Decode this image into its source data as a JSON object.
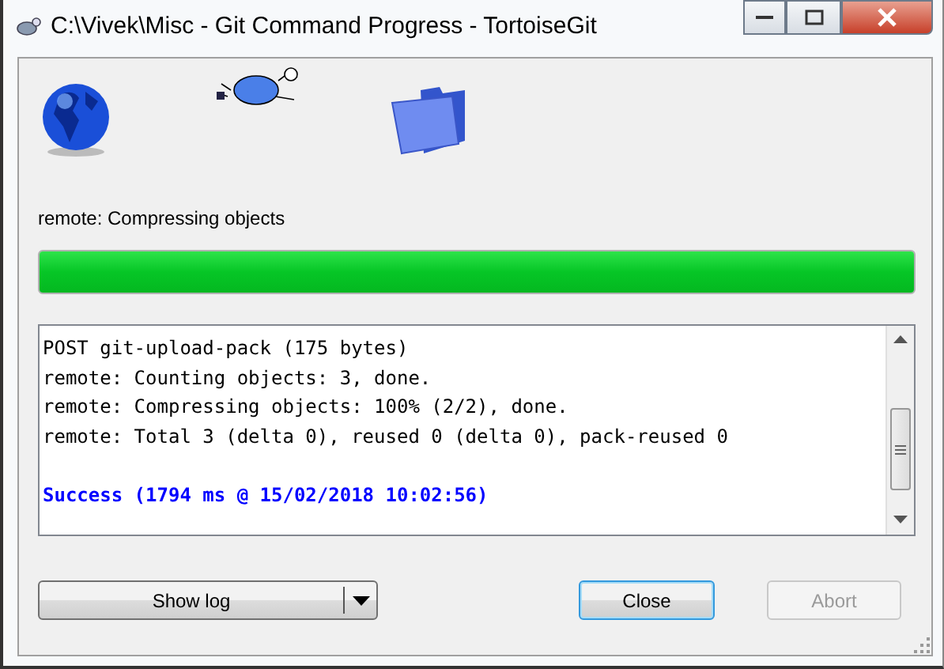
{
  "window": {
    "title": "C:\\Vivek\\Misc - Git Command Progress - TortoiseGit"
  },
  "status": {
    "text": "remote: Compressing objects"
  },
  "progress": {
    "level": 1
  },
  "log": {
    "lines": [
      {
        "kind": "plain",
        "text": "POST git-upload-pack (175 bytes)"
      },
      {
        "kind": "plain",
        "text": "remote: Counting objects: 3, done."
      },
      {
        "kind": "plain",
        "text": "remote: Compressing objects: 100% (2/2), done."
      },
      {
        "kind": "plain",
        "text": "remote: Total 3 (delta 0), reused 0 (delta 0), pack-reused 0"
      },
      {
        "kind": "blank"
      },
      {
        "kind": "success",
        "text": "Success (1794 ms @ 15/02/2018 10:02:56)"
      }
    ]
  },
  "buttons": [
    {
      "kind": "split",
      "label": "Show log",
      "disabled": false,
      "default": false
    },
    {
      "kind": "plain",
      "label": "Close",
      "disabled": false,
      "default": true
    },
    {
      "kind": "plain",
      "label": "Abort",
      "disabled": true,
      "default": false
    }
  ]
}
